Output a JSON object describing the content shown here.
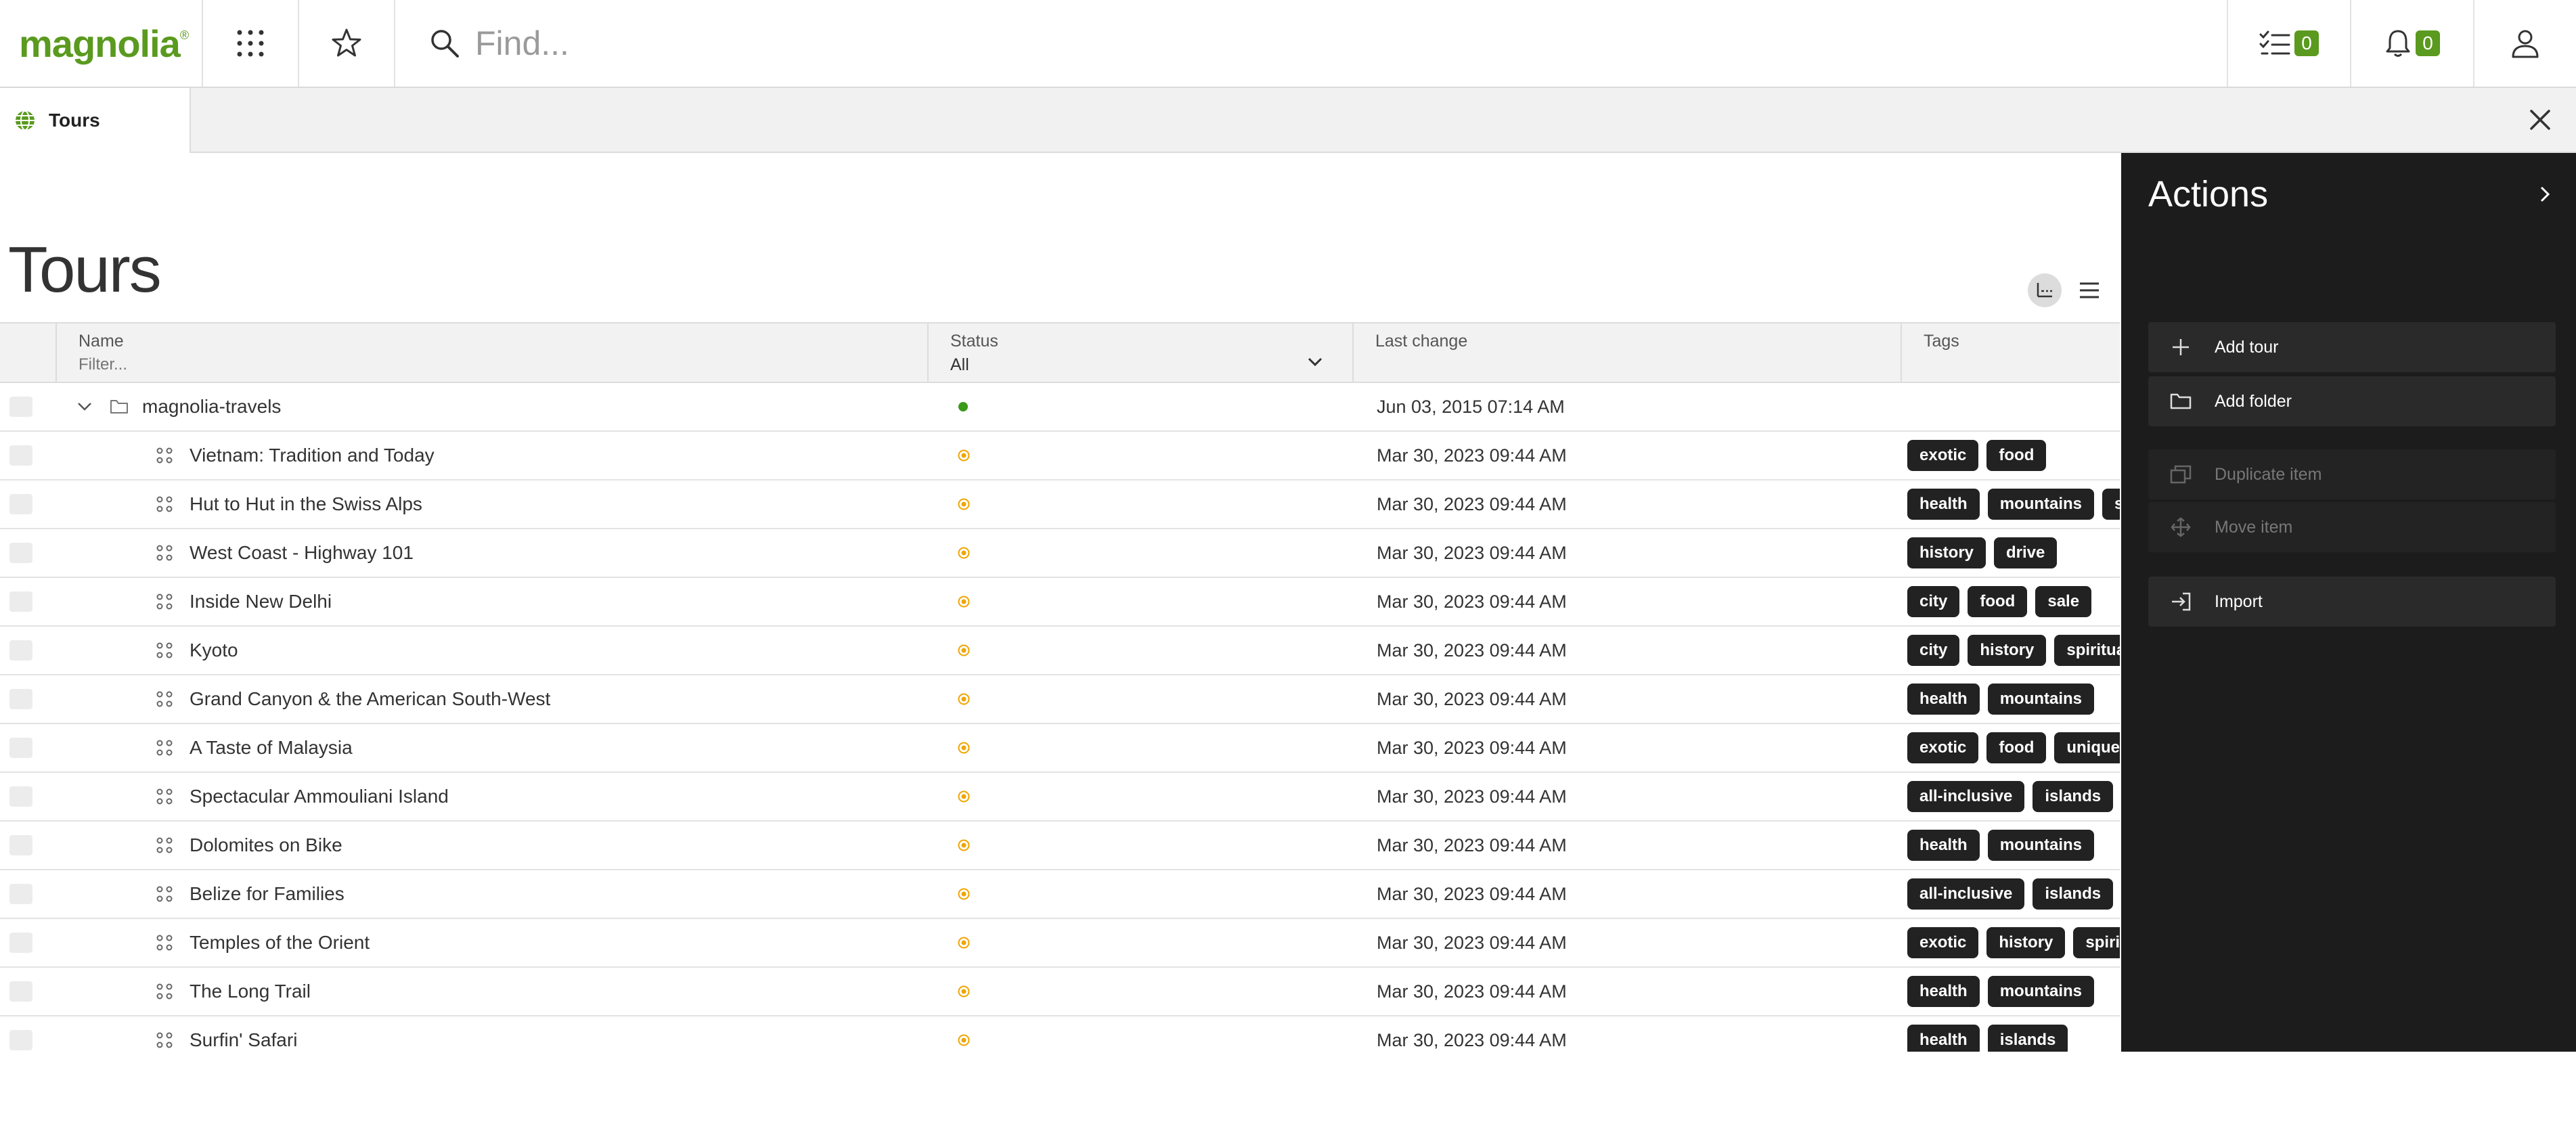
{
  "header": {
    "logo_text": "magnolia",
    "search_placeholder": "Find...",
    "tasks_count": "0",
    "notifications_count": "0"
  },
  "tabs": [
    {
      "label": "Tours"
    }
  ],
  "page": {
    "title": "Tours"
  },
  "grid": {
    "columns": {
      "name": "Name",
      "name_filter_placeholder": "Filter...",
      "status": "Status",
      "status_selected": "All",
      "last_change": "Last change",
      "tags": "Tags"
    },
    "rows": [
      {
        "name": "magnolia-travels",
        "type": "folder",
        "status": "published",
        "last_change": "Jun 03, 2015 07:14 AM",
        "tags": []
      },
      {
        "name": "Vietnam: Tradition and Today",
        "type": "item",
        "status": "modified",
        "last_change": "Mar 30, 2023 09:44 AM",
        "tags": [
          "exotic",
          "food"
        ]
      },
      {
        "name": "Hut to Hut in the Swiss Alps",
        "type": "item",
        "status": "modified",
        "last_change": "Mar 30, 2023 09:44 AM",
        "tags": [
          "health",
          "mountains",
          "s"
        ]
      },
      {
        "name": "West Coast - Highway 101",
        "type": "item",
        "status": "modified",
        "last_change": "Mar 30, 2023 09:44 AM",
        "tags": [
          "history",
          "drive"
        ]
      },
      {
        "name": "Inside New Delhi",
        "type": "item",
        "status": "modified",
        "last_change": "Mar 30, 2023 09:44 AM",
        "tags": [
          "city",
          "food",
          "sale"
        ]
      },
      {
        "name": "Kyoto",
        "type": "item",
        "status": "modified",
        "last_change": "Mar 30, 2023 09:44 AM",
        "tags": [
          "city",
          "history",
          "spiritual"
        ]
      },
      {
        "name": "Grand Canyon & the American South-West",
        "type": "item",
        "status": "modified",
        "last_change": "Mar 30, 2023 09:44 AM",
        "tags": [
          "health",
          "mountains"
        ]
      },
      {
        "name": "A Taste of Malaysia",
        "type": "item",
        "status": "modified",
        "last_change": "Mar 30, 2023 09:44 AM",
        "tags": [
          "exotic",
          "food",
          "unique"
        ]
      },
      {
        "name": "Spectacular Ammouliani Island",
        "type": "item",
        "status": "modified",
        "last_change": "Mar 30, 2023 09:44 AM",
        "tags": [
          "all-inclusive",
          "islands",
          ""
        ]
      },
      {
        "name": "Dolomites on Bike",
        "type": "item",
        "status": "modified",
        "last_change": "Mar 30, 2023 09:44 AM",
        "tags": [
          "health",
          "mountains"
        ]
      },
      {
        "name": "Belize for Families",
        "type": "item",
        "status": "modified",
        "last_change": "Mar 30, 2023 09:44 AM",
        "tags": [
          "all-inclusive",
          "islands"
        ]
      },
      {
        "name": "Temples of the Orient",
        "type": "item",
        "status": "modified",
        "last_change": "Mar 30, 2023 09:44 AM",
        "tags": [
          "exotic",
          "history",
          "spiritu"
        ]
      },
      {
        "name": "The Long Trail",
        "type": "item",
        "status": "modified",
        "last_change": "Mar 30, 2023 09:44 AM",
        "tags": [
          "health",
          "mountains"
        ]
      },
      {
        "name": "Surfin' Safari",
        "type": "item",
        "status": "modified",
        "last_change": "Mar 30, 2023 09:44 AM",
        "tags": [
          "health",
          "islands"
        ]
      }
    ]
  },
  "actions": {
    "title": "Actions",
    "items": [
      {
        "label": "Add tour",
        "icon": "plus-icon",
        "enabled": true
      },
      {
        "label": "Add folder",
        "icon": "add-folder-icon",
        "enabled": true
      },
      {
        "label": "Duplicate item",
        "icon": "duplicate-icon",
        "enabled": false
      },
      {
        "label": "Move item",
        "icon": "move-icon",
        "enabled": false
      },
      {
        "label": "Import",
        "icon": "import-icon",
        "enabled": true
      }
    ]
  },
  "colors": {
    "brand_green": "#5a9a1f",
    "status_published": "#3a9a1a",
    "status_modified": "#f0a500",
    "actions_bg": "#1c1c1c",
    "tag_bg": "#222222"
  }
}
